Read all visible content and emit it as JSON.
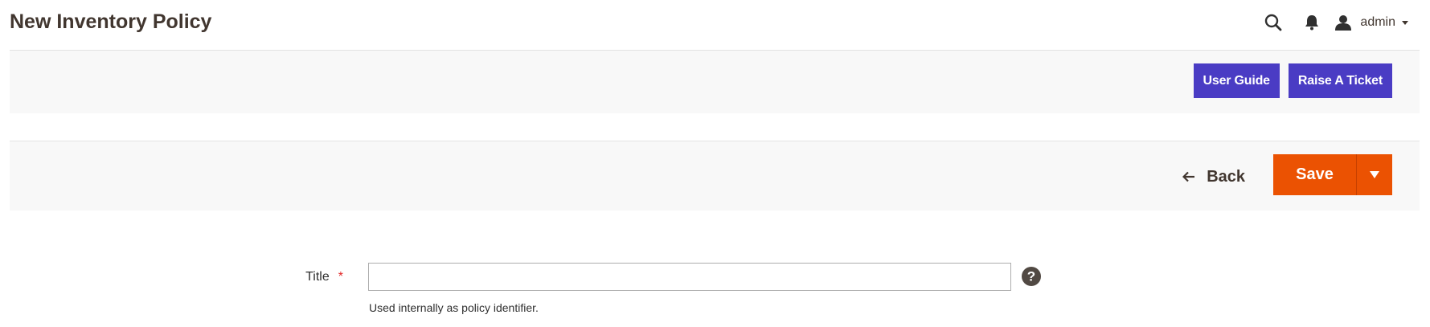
{
  "header": {
    "title": "New Inventory Policy",
    "user_name": "admin",
    "icons": [
      "search-icon",
      "bell-icon",
      "user-icon",
      "chevron-down-icon"
    ]
  },
  "help_bar": {
    "user_guide_label": "User Guide",
    "raise_ticket_label": "Raise A Ticket"
  },
  "actions": {
    "back_label": "Back",
    "save_label": "Save"
  },
  "form": {
    "title_label": "Title",
    "required_mark": "*",
    "title_value": "",
    "title_note": "Used internally as policy identifier."
  },
  "colors": {
    "accent_orange": "#eb5202",
    "button_purple": "#4a3cc4",
    "required_red": "#e22626",
    "text_dark": "#41362f"
  }
}
